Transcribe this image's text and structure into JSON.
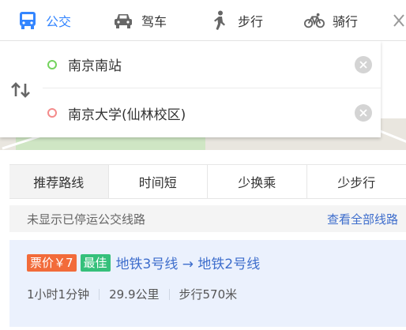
{
  "modes": {
    "bus": {
      "label": "公交",
      "icon": "bus-icon",
      "active": true
    },
    "drive": {
      "label": "驾车",
      "icon": "car-icon"
    },
    "walk": {
      "label": "步行",
      "icon": "walk-icon"
    },
    "bike": {
      "label": "骑行",
      "icon": "bike-icon"
    }
  },
  "inputs": {
    "start": "南京南站",
    "end": "南京大学(仙林校区)"
  },
  "filters": [
    "推荐路线",
    "时间短",
    "少换乘",
    "少步行"
  ],
  "notice": {
    "text": "未显示已停运公交线路",
    "link": "查看全部线路"
  },
  "route": {
    "fare_badge": "票价￥7",
    "best_badge": "最佳",
    "lines": "地铁3号线 → 地铁2号线",
    "duration": "1小时1分钟",
    "distance": "29.9公里",
    "walk": "步行570米"
  },
  "colors": {
    "accent": "#3385ff",
    "link": "#3d6dcc",
    "fare": "#f26b3a",
    "best": "#35c07b",
    "start_dot": "#74d35e",
    "end_dot": "#f48b8b"
  }
}
